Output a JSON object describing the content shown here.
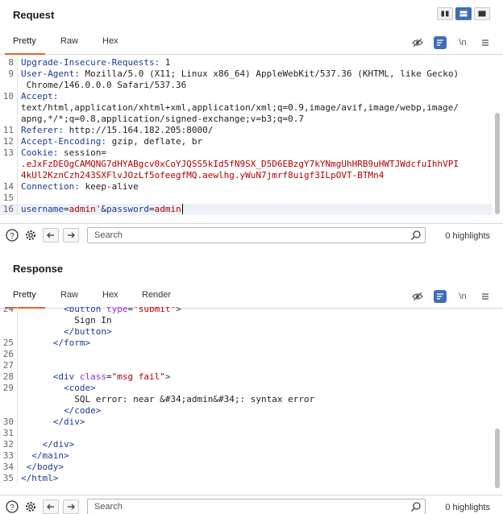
{
  "request": {
    "title": "Request",
    "tabs": [
      "Pretty",
      "Raw",
      "Hex"
    ],
    "tool_newline": "\\n",
    "lines": [
      {
        "n": "8",
        "key": "Upgrade-Insecure-Requests:",
        "val": " 1"
      },
      {
        "n": "9",
        "key": "User-Agent:",
        "val": " Mozilla/5.0 (X11; Linux x86_64) AppleWebKit/537.36 (KHTML, like Gecko)"
      },
      {
        "n": "",
        "key": "",
        "val": " Chrome/146.0.0.0 Safari/537.36"
      },
      {
        "n": "10",
        "key": "Accept:",
        "val": ""
      },
      {
        "n": "",
        "key": "",
        "val": "text/html,application/xhtml+xml,application/xml;q=0.9,image/avif,image/webp,image/"
      },
      {
        "n": "",
        "key": "",
        "val": "apng,*/*;q=0.8,application/signed-exchange;v=b3;q=0.7"
      },
      {
        "n": "11",
        "key": "Referer:",
        "val": " http://15.164.182.205:8000/"
      },
      {
        "n": "12",
        "key": "Accept-Encoding:",
        "val": " gzip, deflate, br"
      },
      {
        "n": "13",
        "key": "Cookie:",
        "val": " session="
      }
    ],
    "cookie_line1": ".eJxFzDEOgCAMQNG7dHYABgcv0xCoYJQSS5kId5fN9SX_D5D6EBzgY7kYNmgUhHRB9uHWTJWdcfuIhhVPI",
    "cookie_line2": "4kUl2KznCzh243SXFlvJOzLf5ofeegfMQ.aewlhg.yWuN7jmrf8uigf3ILpOVT-BTMn4",
    "line14_n": "14",
    "line14_key": "Connection:",
    "line14_val": " keep-alive",
    "line15_n": "15",
    "line16_n": "16",
    "body_k1": "username",
    "body_eq1": "=",
    "body_v1": "admin'",
    "body_amp": "&",
    "body_k2": "password",
    "body_eq2": "=",
    "body_v2": "admin"
  },
  "response": {
    "title": "Response",
    "tabs": [
      "Pretty",
      "Raw",
      "Hex",
      "Render"
    ],
    "tool_newline": "\\n",
    "lines": [
      {
        "n": "24",
        "html": "button_open"
      },
      {
        "n": "",
        "text": "          Sign In"
      },
      {
        "n": "",
        "html": "button_close"
      },
      {
        "n": "25",
        "html": "form_close"
      },
      {
        "n": "26",
        "text": ""
      },
      {
        "n": "27",
        "text": ""
      },
      {
        "n": "28",
        "html": "div_msg"
      },
      {
        "n": "29",
        "html": "code_open"
      },
      {
        "n": "",
        "text": "          SQL error: near &#34;admin&#34;: syntax error"
      },
      {
        "n": "",
        "html": "code_close"
      },
      {
        "n": "30",
        "html": "div_close_a"
      },
      {
        "n": "31",
        "text": ""
      },
      {
        "n": "32",
        "html": "div_close_b"
      },
      {
        "n": "33",
        "html": "main_close"
      },
      {
        "n": "34",
        "html": "body_close"
      },
      {
        "n": "35",
        "html": "html_close"
      }
    ],
    "tokens": {
      "button_tag": "button",
      "type_attr": "type",
      "submit_val": "\"submit\"",
      "form_tag": "form",
      "div_tag": "div",
      "class_attr": "class",
      "msg_val": "\"msg fail\"",
      "code_tag": "code",
      "main_tag": "main",
      "body_tag": "body",
      "html_tag": "html"
    }
  },
  "search": {
    "placeholder": "Search",
    "highlights_text": "0 highlights"
  },
  "colors": {
    "accent": "#e8612c",
    "tool_active": "#3e6fb5",
    "header_key": "#1d3b91",
    "value_red": "#b00000"
  }
}
